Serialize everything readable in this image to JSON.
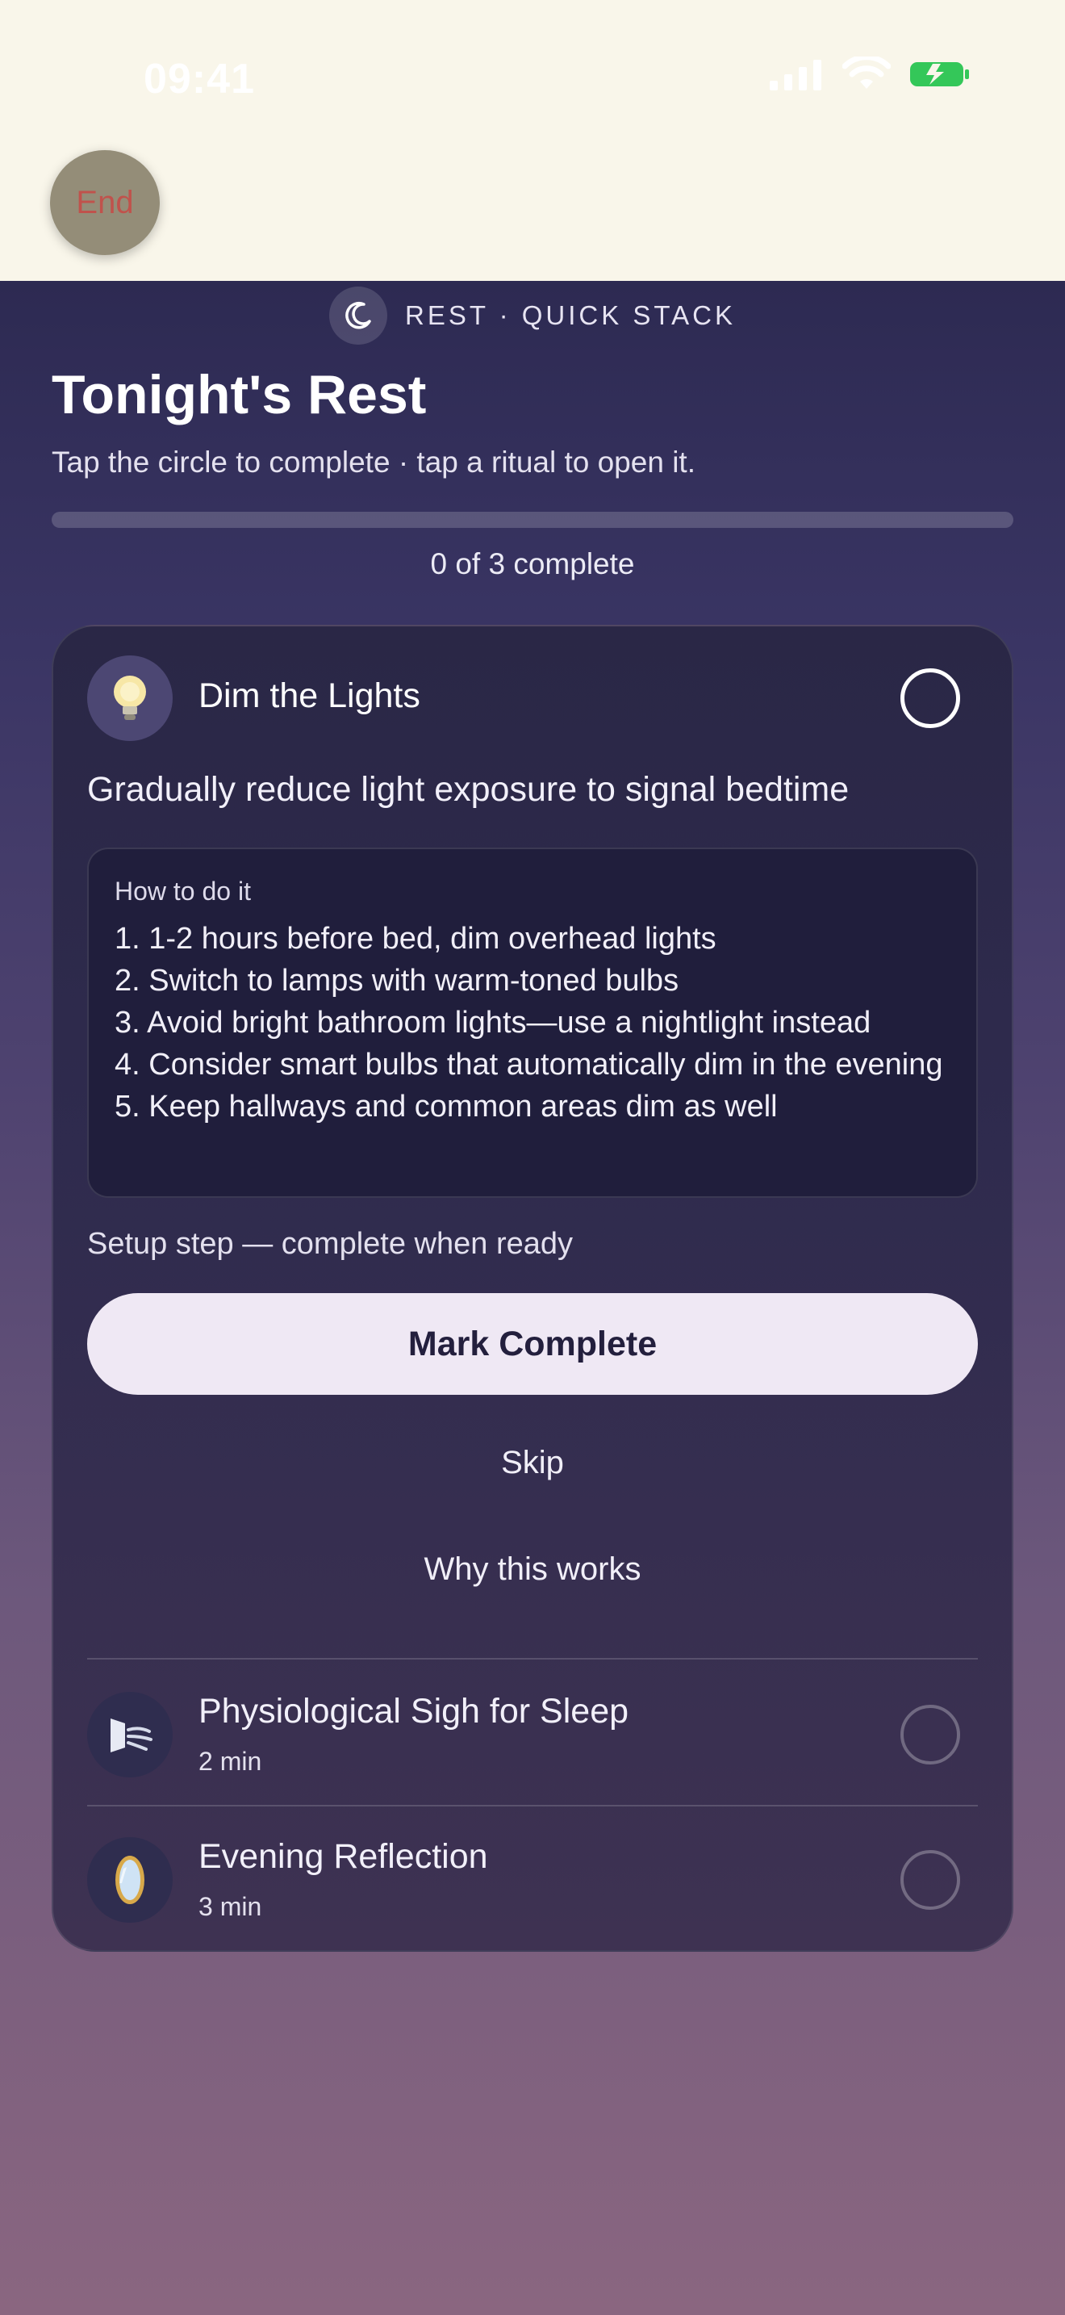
{
  "status_bar": {
    "time": "09:41"
  },
  "end_button": {
    "label": "End"
  },
  "header": {
    "tag": "REST · QUICK STACK",
    "title": "Tonight's Rest",
    "subtitle": "Tap the circle to complete · tap a ritual to open it.",
    "progress_text": "0 of 3 complete",
    "progress_fraction": 0
  },
  "active_ritual": {
    "icon": "lightbulb-icon",
    "title": "Dim the Lights",
    "description": "Gradually reduce light exposure to signal bedtime",
    "howto_heading": "How to do it",
    "steps": [
      "1. 1-2 hours before bed, dim overhead lights",
      "2. Switch to lamps with warm-toned bulbs",
      "3. Avoid bright bathroom lights—use a nightlight instead",
      "4. Consider smart bulbs that automatically dim in the evening",
      "5. Keep hallways and common areas dim as well"
    ],
    "setup_note": "Setup step — complete when ready",
    "mark_complete_label": "Mark Complete",
    "skip_label": "Skip",
    "why_label": "Why this works"
  },
  "other_rituals": [
    {
      "icon": "breath-icon",
      "title": "Physiological Sigh for Sleep",
      "duration": "2 min"
    },
    {
      "icon": "mirror-icon",
      "title": "Evening Reflection",
      "duration": "3 min"
    }
  ],
  "colors": {
    "accent_button": "#efe8f4",
    "battery": "#34c759",
    "end_text": "#c0524c"
  }
}
